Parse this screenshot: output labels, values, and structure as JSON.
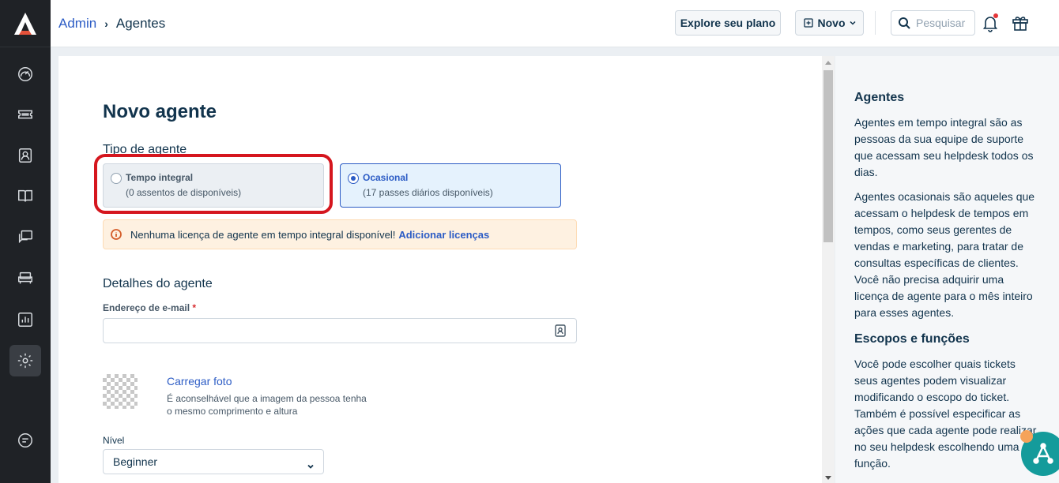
{
  "header": {
    "breadcrumb": [
      "Admin",
      "Agentes"
    ],
    "explore_label": "Explore seu plano",
    "new_label": "Novo",
    "search_placeholder": "Pesquisar"
  },
  "sidebar": {
    "items": [
      {
        "name": "dashboard",
        "icon": "gauge-icon"
      },
      {
        "name": "tickets",
        "icon": "ticket-icon"
      },
      {
        "name": "contacts",
        "icon": "contact-icon"
      },
      {
        "name": "knowledge-base",
        "icon": "book-icon"
      },
      {
        "name": "conversations",
        "icon": "chat-icon"
      },
      {
        "name": "assets",
        "icon": "sofa-icon"
      },
      {
        "name": "reports",
        "icon": "chart-icon"
      },
      {
        "name": "admin",
        "icon": "gear-icon",
        "active": true
      },
      {
        "name": "notes",
        "icon": "note-icon"
      }
    ]
  },
  "form": {
    "title": "Novo agente",
    "agent_type_label": "Tipo de agente",
    "options": [
      {
        "title": "Tempo integral",
        "subtitle": "(0 assentos de disponíveis)",
        "selected": false
      },
      {
        "title": "Ocasional",
        "subtitle": "(17 passes diários disponíveis)",
        "selected": true
      }
    ],
    "alert_text": "Nenhuma licença de agente em tempo integral disponível!",
    "alert_link": "Adicionar licenças",
    "details_title": "Detalhes do agente",
    "email_label": "Endereço de e-mail",
    "email_required": "*",
    "email_value": "",
    "upload_link": "Carregar foto",
    "upload_hint": "É aconselhável que a imagem da pessoa tenha o mesmo comprimento e altura",
    "level_label": "Nível",
    "level_value": "Beginner"
  },
  "info": {
    "title1": "Agentes",
    "p1": "Agentes em tempo integral são as pessoas da sua equipe de suporte que acessam seu helpdesk todos os dias.",
    "p2": "Agentes ocasionais são aqueles que acessam o helpdesk de tempos em tempos, como seus gerentes de vendas e marketing, para tratar de consultas específicas de clientes. Você não precisa adquirir uma licença de agente para o mês inteiro para esses agentes.",
    "title2": "Escopos e funções",
    "p3": "Você pode escolher quais tickets seus agentes podem visualizar modificando o escopo do ticket. Também é possível especificar as ações que cada agente pode realizar no seu helpdesk escolhendo uma função."
  },
  "colors": {
    "sidebar_bg": "#1f2226",
    "accent": "#2c5cc5",
    "highlight": "#d5161e",
    "alert_bg": "#fef1e1",
    "fab": "#149b9b"
  }
}
